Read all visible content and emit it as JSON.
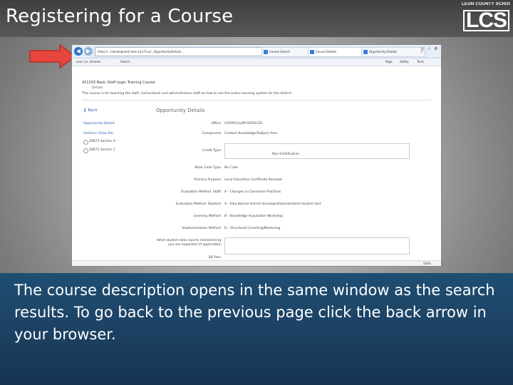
{
  "slide": {
    "title": "Registering for a Course",
    "caption": "The course description opens in the same window as the search results. To go back to the previous page click the back arrow in your browser.",
    "logo": {
      "top_text": "LEON COUNTY SCHOOLS",
      "mark": "LCS"
    },
    "colors": {
      "arrow": "#e8453c",
      "band": "#1f4e73",
      "title_bar": "#4a4a4a"
    }
  },
  "browser": {
    "back_icon": "back-arrow-icon",
    "forward_icon": "forward-arrow-icon",
    "address": "https://...idevelopment.leon.k12.fl.us/...OpportunityDetails...",
    "tabs": [
      {
        "label": "Course Search"
      },
      {
        "label": "Course Details"
      },
      {
        "label": "Opportunity Details"
      }
    ],
    "favorites": [
      {
        "label": "Leon Co. Schools"
      },
      {
        "label": "Search"
      }
    ],
    "commands": [
      "Page",
      "Safety",
      "Tools"
    ],
    "zoom": "100%"
  },
  "page": {
    "course_heading": "421103 Basic Staff Login Training Course",
    "course_sub": "Details",
    "description": "This course is for teaching the staff, instructional and administrative staff on how to use the online learning system for the district.",
    "back_label": "Back",
    "panel_title": "Opportunity Details",
    "sidebar": {
      "links": [
        "Opportunity Details",
        "Sections (View All)"
      ],
      "sections": [
        "26873 Section A",
        "26873 Section C"
      ]
    },
    "fields": [
      {
        "label": "Office:",
        "value": "CURRICULUM SERVICES"
      },
      {
        "label": "Component:",
        "value": "Content Knowledge/Subject Area"
      },
      {
        "label": "Credit Type:",
        "value": "Non-Certification"
      },
      {
        "label": "Bank Code Type:",
        "value": "No Code"
      },
      {
        "label": "Primary Purpose:",
        "value": "Local Education Certificate Renewal"
      },
      {
        "label": "Evaluation Method, Staff:",
        "value": "A - Changes in Classroom Practices"
      },
      {
        "label": "Evaluation Method, Student:",
        "value": "A - Educational district developed/standardized student test"
      },
      {
        "label": "Learning Method:",
        "value": "B - Knowledge Acquisition Workshop"
      },
      {
        "label": "Implementation Method:",
        "value": "D - Structured Coaching/Mentoring"
      },
      {
        "label": "What student data reports monitored by you are requested (if applicable):",
        "value": ""
      },
      {
        "label": "SB Plan:",
        "value": ""
      }
    ]
  }
}
